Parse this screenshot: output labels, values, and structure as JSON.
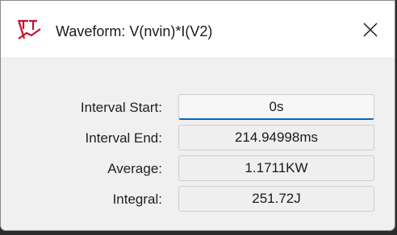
{
  "window": {
    "title": "Waveform: V(nvin)*I(V2)",
    "icon": "ltspice-app-icon",
    "close_icon": "close-icon"
  },
  "fields": [
    {
      "label": "Interval Start:",
      "value": "0s"
    },
    {
      "label": "Interval End:",
      "value": "214.94998ms"
    },
    {
      "label": "Average:",
      "value": "1.1711KW"
    },
    {
      "label": "Integral:",
      "value": "251.72J"
    }
  ],
  "colors": {
    "accent": "#0067c0",
    "icon_red": "#c8102e"
  }
}
